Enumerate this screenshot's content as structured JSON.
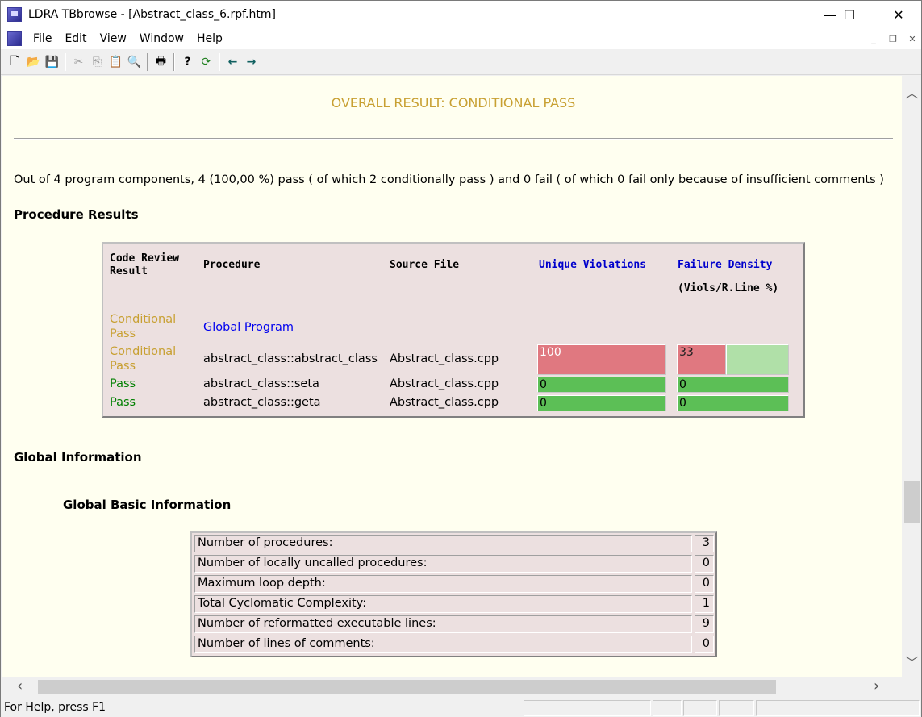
{
  "window": {
    "title": "LDRA TBbrowse - [Abstract_class_6.rpf.htm]",
    "controls": {
      "minimize": "—",
      "maximize": "☐",
      "close": "✕"
    }
  },
  "menu": [
    "File",
    "Edit",
    "View",
    "Window",
    "Help"
  ],
  "mdi_controls": {
    "minimize": "_",
    "restore": "❐",
    "close": "✕"
  },
  "toolbar": [
    {
      "name": "new-icon",
      "glyph": "🗋"
    },
    {
      "name": "open-icon",
      "glyph": "📂"
    },
    {
      "name": "save-icon",
      "glyph": "💾"
    },
    {
      "name": "cut-icon",
      "glyph": "✂"
    },
    {
      "name": "copy-icon",
      "glyph": "⎘"
    },
    {
      "name": "paste-icon",
      "glyph": "📋"
    },
    {
      "name": "find-icon",
      "glyph": "🔍"
    },
    {
      "name": "print-icon",
      "glyph": "🖶"
    },
    {
      "name": "help-icon",
      "glyph": "?"
    },
    {
      "name": "refresh-icon",
      "glyph": "⟳"
    },
    {
      "name": "back-icon",
      "glyph": "←"
    },
    {
      "name": "forward-icon",
      "glyph": "→"
    }
  ],
  "report": {
    "overall": "OVERALL RESULT: CONDITIONAL PASS",
    "summary": "Out of 4 program components, 4 (100,00 %) pass ( of which 2 conditionally pass ) and 0 fail ( of which 0 fail only because of insufficient comments )",
    "procedure_results_heading": "Procedure Results",
    "proc_table": {
      "headers": {
        "result": "Code Review Result",
        "procedure": "Procedure",
        "source": "Source File",
        "violations": "Unique Violations",
        "density": "Failure Density",
        "density_unit": "(Viols/R.Line %)"
      },
      "rows": [
        {
          "result": "Conditional Pass",
          "procedure": "Global Program",
          "source": "",
          "violations": "",
          "density": ""
        },
        {
          "result": "Conditional Pass",
          "procedure": "abstract_class::abstract_class",
          "source": "Abstract_class.cpp",
          "violations": "100",
          "density": "33"
        },
        {
          "result": "Pass",
          "procedure": "abstract_class::seta",
          "source": "Abstract_class.cpp",
          "violations": "0",
          "density": "0"
        },
        {
          "result": "Pass",
          "procedure": "abstract_class::geta",
          "source": "Abstract_class.cpp",
          "violations": "0",
          "density": "0"
        }
      ]
    },
    "global_info_heading": "Global Information",
    "global_basic_heading": "Global Basic Information",
    "basic_info": [
      {
        "label": "Number of procedures:",
        "value": "3"
      },
      {
        "label": "Number of locally uncalled procedures:",
        "value": "0"
      },
      {
        "label": "Maximum loop depth:",
        "value": "0"
      },
      {
        "label": "Total Cyclomatic Complexity:",
        "value": "1"
      },
      {
        "label": "Number of reformatted executable lines:",
        "value": "9"
      },
      {
        "label": "Number of lines of comments:",
        "value": "0"
      }
    ]
  },
  "status": "For Help, press F1",
  "colors": {
    "background": "#fffff0",
    "conditional": "#c8a032",
    "pass": "#008000",
    "link": "#0000ee",
    "fail_bar": "#e07880",
    "pass_bar": "#5cbf56"
  }
}
